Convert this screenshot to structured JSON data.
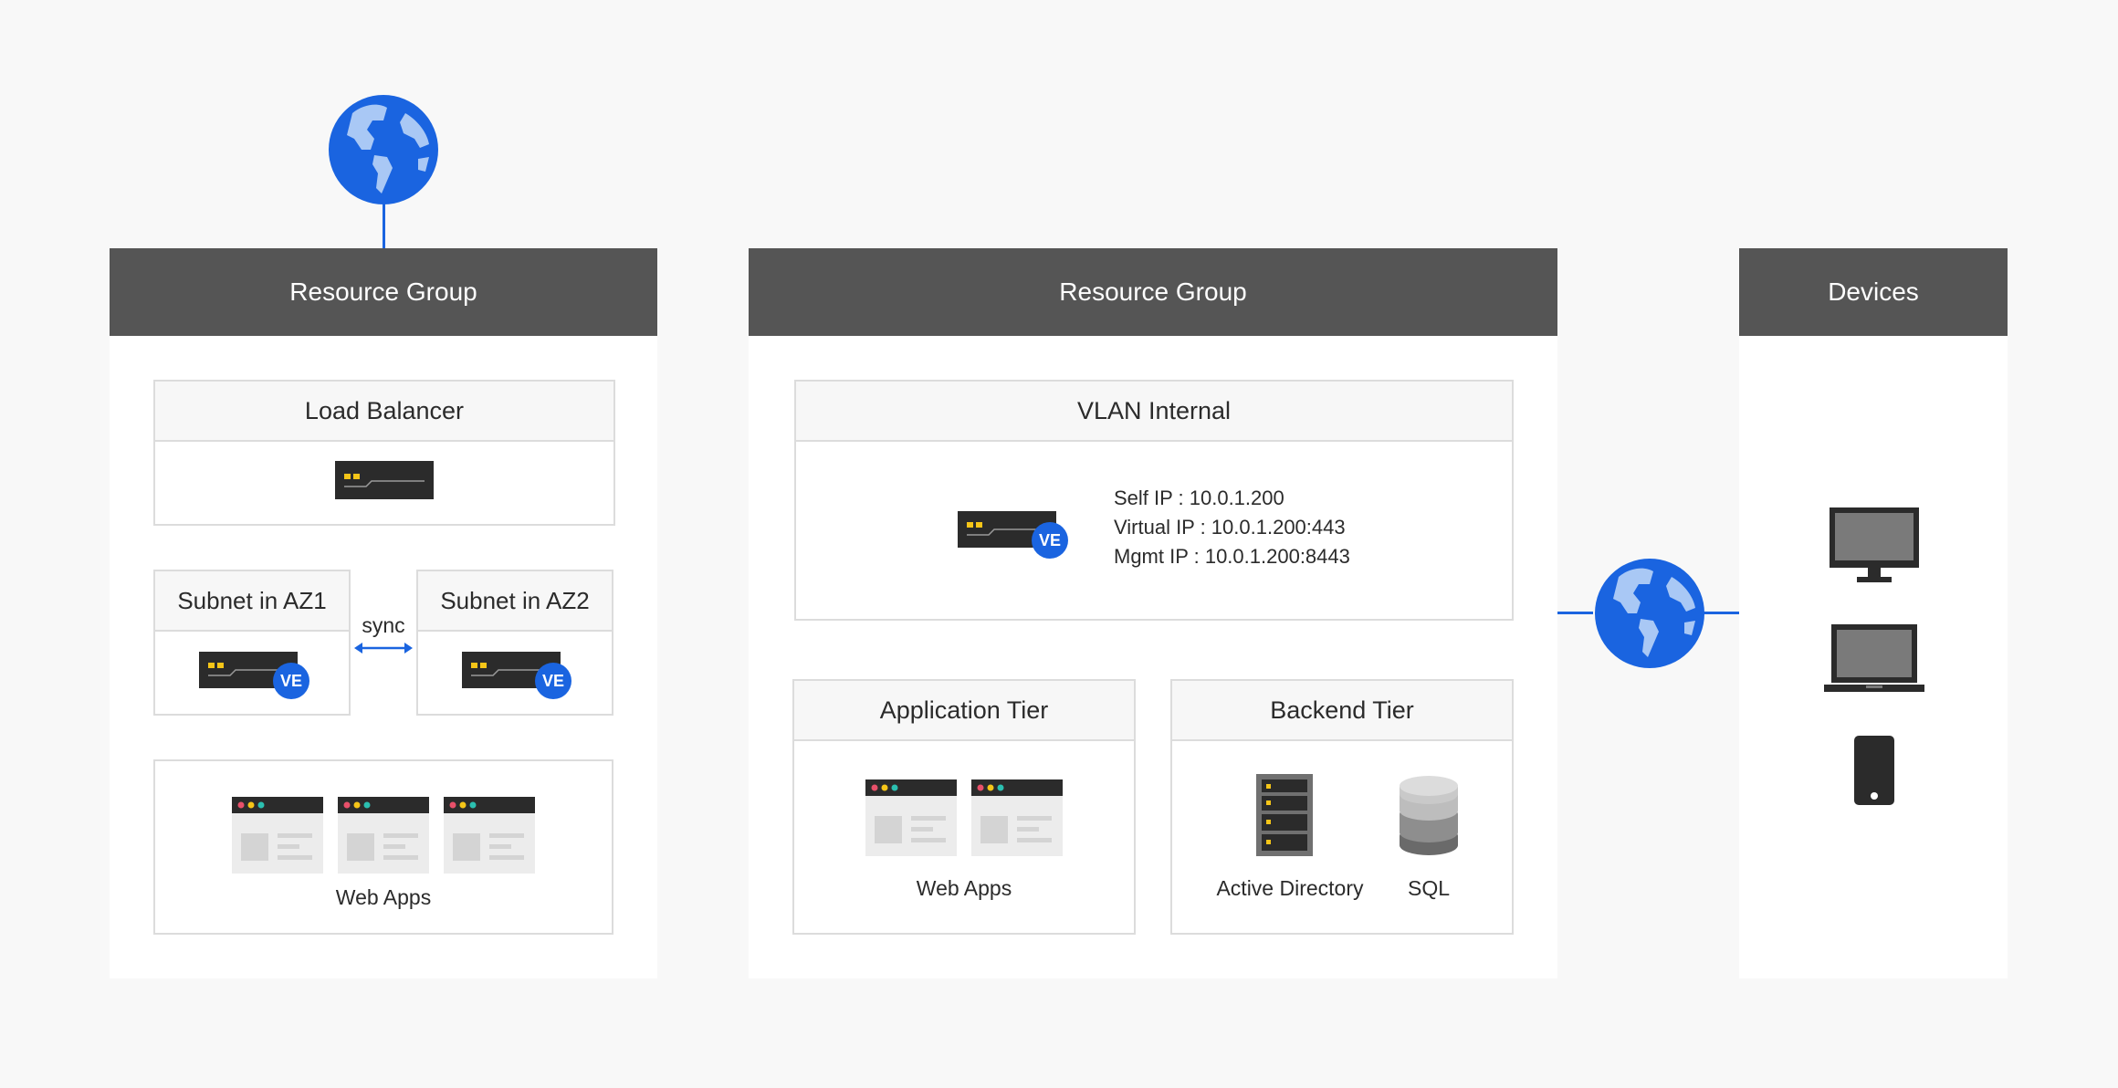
{
  "left_group": {
    "title": "Resource Group",
    "load_balancer": {
      "title": "Load Balancer"
    },
    "subnet_az1": {
      "title": "Subnet in AZ1",
      "badge": "VE"
    },
    "subnet_az2": {
      "title": "Subnet in AZ2",
      "badge": "VE"
    },
    "sync_label": "sync",
    "web_apps_label": "Web Apps"
  },
  "middle_group": {
    "title": "Resource Group",
    "vlan": {
      "title": "VLAN Internal",
      "badge": "VE",
      "self_ip": "Self IP : 10.0.1.200",
      "virtual_ip": "Virtual IP : 10.0.1.200:443",
      "mgmt_ip": "Mgmt IP : 10.0.1.200:8443"
    },
    "application_tier": {
      "title": "Application Tier",
      "label": "Web Apps"
    },
    "backend_tier": {
      "title": "Backend Tier",
      "ad_label": "Active Directory",
      "sql_label": "SQL"
    }
  },
  "devices": {
    "title": "Devices",
    "items": [
      "monitor-icon",
      "laptop-icon",
      "phone-icon"
    ]
  },
  "colors": {
    "accent": "#1a64e0",
    "header": "#555555",
    "background": "#f8f8f8"
  }
}
